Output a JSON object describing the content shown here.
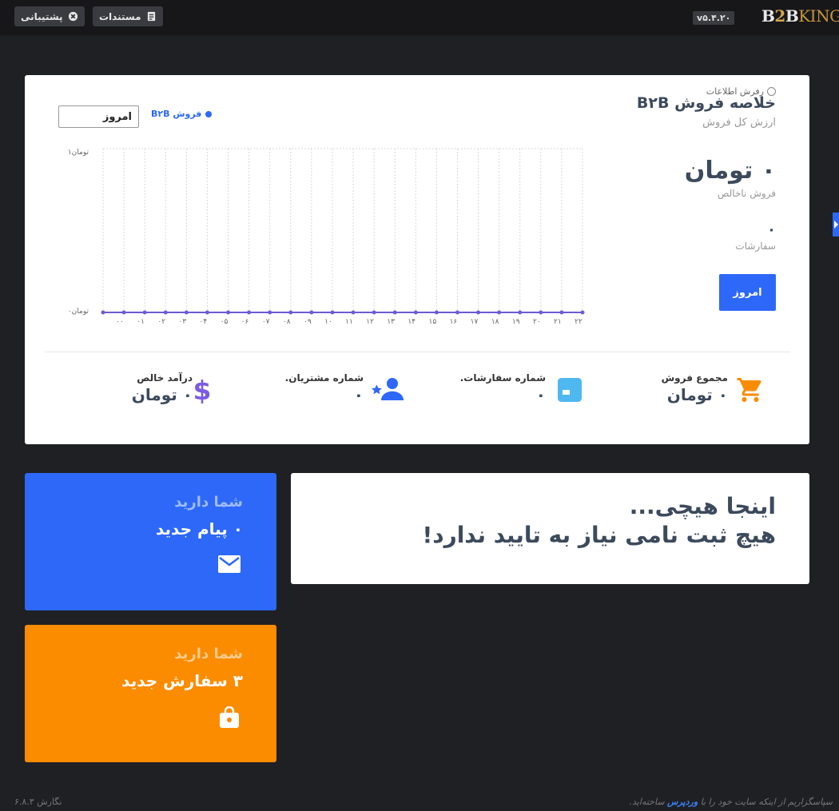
{
  "topbar": {
    "support_label": "پشتیبانی",
    "docs_label": "مستندات",
    "version": "v۵.۴.۲۰",
    "logo": {
      "b": "B",
      "two": "2",
      "b2": "B",
      "king": "KING"
    }
  },
  "summary": {
    "refresh_label": "رفرش اطلاعات",
    "title": "خلاصه فروش B۲B",
    "subtitle": "ارزش کل فروش",
    "gross_value": "۰ تومان",
    "gross_label": "فروش ناخالص",
    "orders_value": "۰",
    "orders_label": "سفارشات",
    "today_button": "امروز",
    "range_select": "امروز",
    "legend_label": "فروش B۲B"
  },
  "chart_data": {
    "type": "line",
    "x": [
      "۰۰",
      "۰۱",
      "۰۲",
      "۰۳",
      "۰۴",
      "۰۵",
      "۰۶",
      "۰۷",
      "۰۸",
      "۰۹",
      "۱۰",
      "۱۱",
      "۱۲",
      "۱۳",
      "۱۴",
      "۱۵",
      "۱۶",
      "۱۷",
      "۱۸",
      "۱۹",
      "۲۰",
      "۲۱",
      "۲۲"
    ],
    "series": [
      {
        "name": "فروش B۲B",
        "values": [
          0,
          0,
          0,
          0,
          0,
          0,
          0,
          0,
          0,
          0,
          0,
          0,
          0,
          0,
          0,
          0,
          0,
          0,
          0,
          0,
          0,
          0,
          0,
          0
        ]
      }
    ],
    "y_tick_labels": [
      "تومان۰",
      "تومان۱"
    ],
    "ylim": [
      0,
      1
    ],
    "grid": true,
    "color": "#6b5bd6"
  },
  "stats": [
    {
      "label": "مجموع فروش",
      "value": "۰ تومان",
      "icon": "cart-icon",
      "color": "#fb8c00"
    },
    {
      "label": "شماره سفارشات.",
      "value": "۰",
      "icon": "box-icon",
      "color": "#4fb8f0"
    },
    {
      "label": "شماره مشتریان.",
      "value": "۰",
      "icon": "customer-star-icon",
      "color": "#2d68f8"
    },
    {
      "label": "درآمد خالص",
      "value": "۰ تومان",
      "icon": "dollar-icon",
      "color": "#7b5ce0"
    }
  ],
  "empty_notice": {
    "line1": "اینجا هیچی...",
    "line2": "هیچ ثبت نامی نیاز به تایید ندارد!"
  },
  "messages_card": {
    "have": "شما دارید",
    "main": "۰ پیام جدید",
    "icon": "mail-icon"
  },
  "orders_card": {
    "have": "شما دارید",
    "main": "۳ سفارش جدید",
    "icon": "shopping-bag-icon"
  },
  "footer": {
    "thanks_pre": "سپاسگزاریم از اینکه سایت خود را با",
    "wordpress_link": "وردپرس",
    "thanks_post": "ساخته‌اید.",
    "version": "نگارش ۶.۸.۳"
  }
}
